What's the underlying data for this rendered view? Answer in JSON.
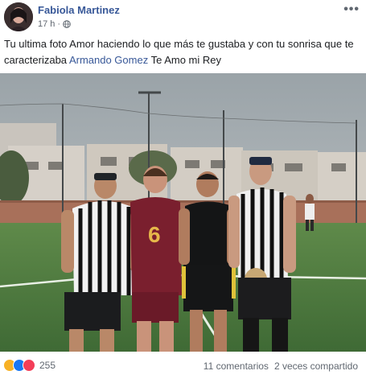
{
  "post": {
    "author": "Fabiola Martinez",
    "time": "17 h",
    "more": "•••",
    "text_before": "Tu ultima foto Amor haciendo lo que más te gustaba y con tu sonrisa que te caracterizaba ",
    "mention": "Armando Gomez",
    "text_after": " Te Amo mi Rey",
    "jersey_number": "6"
  },
  "footer": {
    "reaction_icons": [
      "sad-icon",
      "like-icon",
      "love-icon"
    ],
    "reaction_count": "255",
    "comments": "11 comentarios",
    "shares": "2 veces compartido"
  },
  "colors": {
    "link": "#385898",
    "meta": "#606770",
    "sad": "#f7b125",
    "like": "#1877f2",
    "love": "#f33e58"
  }
}
